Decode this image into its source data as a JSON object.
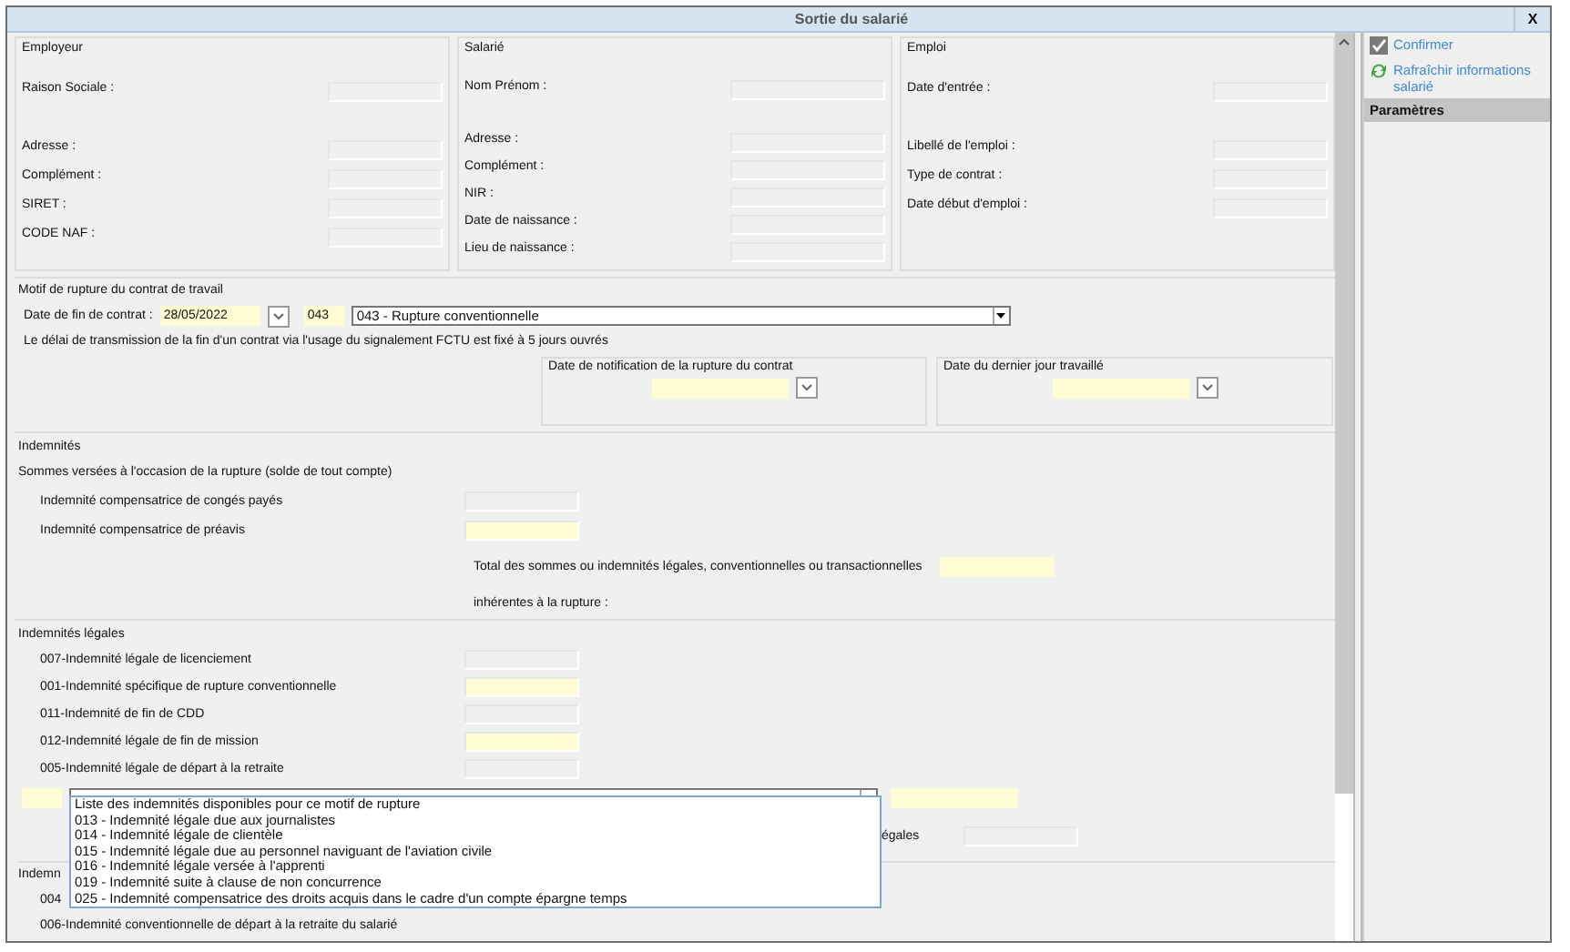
{
  "window": {
    "title": "Sortie du salarié",
    "close": "X"
  },
  "panels": [
    {
      "title": "Employeur",
      "fields": [
        {
          "label": "Raison Sociale :",
          "kind": "double"
        },
        {
          "label": "Adresse :",
          "kind": "single"
        },
        {
          "label": "Complément :",
          "kind": "single"
        },
        {
          "label": "SIRET :",
          "kind": "single"
        },
        {
          "label": "CODE NAF :",
          "kind": "single"
        }
      ]
    },
    {
      "title": "Salarié",
      "fields": [
        {
          "label": "Nom Prénom :",
          "kind": "double"
        },
        {
          "label": "Adresse :",
          "kind": "single"
        },
        {
          "label": "Complément :",
          "kind": "single"
        },
        {
          "label": "NIR :",
          "kind": "single"
        },
        {
          "label": "Date de naissance :",
          "kind": "single"
        },
        {
          "label": "Lieu de naissance :",
          "kind": "single"
        }
      ]
    },
    {
      "title": "Emploi",
      "fields": [
        {
          "label": "Date d'entrée :",
          "kind": "double"
        },
        {
          "label": "Libellé de l'emploi :",
          "kind": "single"
        },
        {
          "label": "Type de contrat :",
          "kind": "single"
        },
        {
          "label": "Date début d'emploi :",
          "kind": "single"
        }
      ]
    }
  ],
  "motif": {
    "title": "Motif de rupture du contrat de travail",
    "date_label": "Date de fin de contrat :",
    "date_value": "28/05/2022",
    "code": "043",
    "reason": "043 - Rupture conventionnelle",
    "notice": "Le délai de transmission de la fin d'un contrat via l'usage du signalement FCTU est fixé à 5 jours ouvrés"
  },
  "date_boxes": [
    {
      "title": "Date de notification de la rupture du contrat"
    },
    {
      "title": "Date du dernier jour travaillé"
    }
  ],
  "indemnites": {
    "title": "Indemnités",
    "subtitle": "Sommes versées à l'occasion de la rupture (solde de tout compte)",
    "rows": [
      {
        "label": "Indemnité compensatrice de congés payés",
        "required": false
      },
      {
        "label": "Indemnité compensatrice de préavis",
        "required": true
      }
    ],
    "total_lines": [
      "Total des sommes ou indemnités légales, conventionnelles ou transactionnelles",
      "inhérentes à la rupture :"
    ]
  },
  "legales": {
    "title": "Indemnités légales",
    "rows": [
      {
        "label": "007-Indemnité légale de licenciement",
        "required": false
      },
      {
        "label": "001-Indemnité spécifique de rupture conventionnelle",
        "required": true
      },
      {
        "label": "011-Indemnité de fin de CDD",
        "required": false
      },
      {
        "label": "012-Indemnité légale de fin de mission",
        "required": true
      },
      {
        "label": "005-Indemnité légale de départ à la retraite",
        "required": false
      }
    ]
  },
  "other_dropdown": {
    "expanded": true,
    "options": [
      "Liste des indemnités disponibles pour ce motif de rupture",
      "013 - Indemnité légale due aux journalistes",
      "014 - Indemnité légale de clientèle",
      "015 - Indemnité légale due au personnel naviguant de l'aviation civile",
      "016 - Indemnité légale versée à l'apprenti",
      "019 - Indemnité suite à clause de non concurrence",
      "025 - Indemnité compensatrice des droits acquis dans le cadre d'un compte épargne temps"
    ]
  },
  "partly_hidden": {
    "total_label": "égales",
    "section": "Indemn",
    "row_code": "004",
    "last_row": "006-Indemnité conventionnelle de départ à la retraite du salarié"
  },
  "sidebar": {
    "actions": [
      {
        "label": "Confirmer",
        "kind": "check"
      },
      {
        "label": "Rafraîchir informations salarié",
        "kind": "refresh"
      }
    ],
    "section": "Paramètres"
  }
}
